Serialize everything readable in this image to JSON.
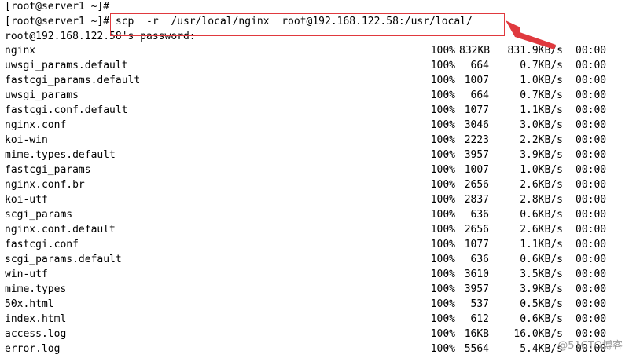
{
  "terminal": {
    "prompt_line": "[root@server1 ~]#",
    "command_prompt": "[root@server1 ~]#",
    "command": " scp  -r  /usr/local/nginx  root@192.168.122.58:/usr/local/",
    "password_prompt": "root@192.168.122.58's password:",
    "files": [
      {
        "name": "nginx",
        "percent": "100%",
        "size": "832KB",
        "rate": "831.9KB/s",
        "eta": "00:00"
      },
      {
        "name": "uwsgi_params.default",
        "percent": "100%",
        "size": "664",
        "rate": "0.7KB/s",
        "eta": "00:00"
      },
      {
        "name": "fastcgi_params.default",
        "percent": "100%",
        "size": "1007",
        "rate": "1.0KB/s",
        "eta": "00:00"
      },
      {
        "name": "uwsgi_params",
        "percent": "100%",
        "size": "664",
        "rate": "0.7KB/s",
        "eta": "00:00"
      },
      {
        "name": "fastcgi.conf.default",
        "percent": "100%",
        "size": "1077",
        "rate": "1.1KB/s",
        "eta": "00:00"
      },
      {
        "name": "nginx.conf",
        "percent": "100%",
        "size": "3046",
        "rate": "3.0KB/s",
        "eta": "00:00"
      },
      {
        "name": "koi-win",
        "percent": "100%",
        "size": "2223",
        "rate": "2.2KB/s",
        "eta": "00:00"
      },
      {
        "name": "mime.types.default",
        "percent": "100%",
        "size": "3957",
        "rate": "3.9KB/s",
        "eta": "00:00"
      },
      {
        "name": "fastcgi_params",
        "percent": "100%",
        "size": "1007",
        "rate": "1.0KB/s",
        "eta": "00:00"
      },
      {
        "name": "nginx.conf.br",
        "percent": "100%",
        "size": "2656",
        "rate": "2.6KB/s",
        "eta": "00:00"
      },
      {
        "name": "koi-utf",
        "percent": "100%",
        "size": "2837",
        "rate": "2.8KB/s",
        "eta": "00:00"
      },
      {
        "name": "scgi_params",
        "percent": "100%",
        "size": "636",
        "rate": "0.6KB/s",
        "eta": "00:00"
      },
      {
        "name": "nginx.conf.default",
        "percent": "100%",
        "size": "2656",
        "rate": "2.6KB/s",
        "eta": "00:00"
      },
      {
        "name": "fastcgi.conf",
        "percent": "100%",
        "size": "1077",
        "rate": "1.1KB/s",
        "eta": "00:00"
      },
      {
        "name": "scgi_params.default",
        "percent": "100%",
        "size": "636",
        "rate": "0.6KB/s",
        "eta": "00:00"
      },
      {
        "name": "win-utf",
        "percent": "100%",
        "size": "3610",
        "rate": "3.5KB/s",
        "eta": "00:00"
      },
      {
        "name": "mime.types",
        "percent": "100%",
        "size": "3957",
        "rate": "3.9KB/s",
        "eta": "00:00"
      },
      {
        "name": "50x.html",
        "percent": "100%",
        "size": "537",
        "rate": "0.5KB/s",
        "eta": "00:00"
      },
      {
        "name": "index.html",
        "percent": "100%",
        "size": "612",
        "rate": "0.6KB/s",
        "eta": "00:00"
      },
      {
        "name": "access.log",
        "percent": "100%",
        "size": "16KB",
        "rate": "16.0KB/s",
        "eta": "00:00"
      },
      {
        "name": "error.log",
        "percent": "100%",
        "size": "5564",
        "rate": "5.4KB/s",
        "eta": "00:00"
      }
    ]
  },
  "watermark": "@51CTO博客",
  "annotation_color": "#e0393e"
}
